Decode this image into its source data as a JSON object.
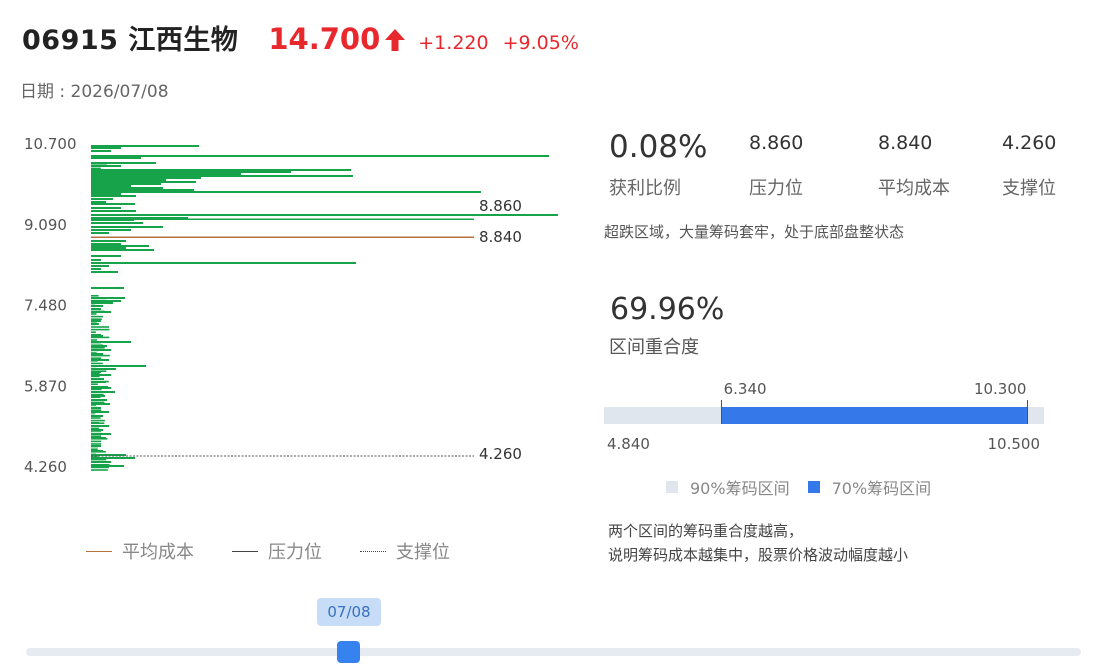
{
  "header": {
    "stock_code_name": "06915 江西生物",
    "price": "14.700",
    "price_direction_icon": "up-arrow-icon",
    "change": "+1.220",
    "change_pct": "+9.05%",
    "up_color": "#e8282d"
  },
  "date_line": "日期 : 2026/07/08",
  "chip_chart": {
    "y_ticks": [
      "10.700",
      "9.090",
      "7.480",
      "5.870",
      "4.260"
    ],
    "lines": {
      "pressure": "8.860",
      "avg_cost": "8.840",
      "support": "4.260"
    },
    "bar_color": "#16a34a",
    "avg_cost_color": "#b8733c"
  },
  "legend": {
    "avg_cost": "平均成本",
    "pressure": "压力位",
    "support": "支撑位"
  },
  "stats": {
    "profit_ratio_value": "0.08%",
    "profit_ratio_label": "获利比例",
    "pressure_value": "8.860",
    "pressure_label": "压力位",
    "avg_cost_value": "8.840",
    "avg_cost_label": "平均成本",
    "support_value": "4.260",
    "support_label": "支撑位"
  },
  "description": "超跌区域，大量筹码套牢，处于底部盘整状态",
  "overlap": {
    "value": "69.96%",
    "label": "区间重合度"
  },
  "range_bar": {
    "outer_low": "4.840",
    "outer_high": "10.500",
    "inner_low": "6.340",
    "inner_high": "10.300",
    "outer_color": "#dfe6ee",
    "inner_color": "#3478ea"
  },
  "range_legend": {
    "range90": "90%筹码区间",
    "range70": "70%筹码区间"
  },
  "note": {
    "line1": "两个区间的筹码重合度越高，",
    "line2": "说明筹码成本越集中，股票价格波动幅度越小"
  },
  "timeline": {
    "tooltip": "07/08"
  }
}
